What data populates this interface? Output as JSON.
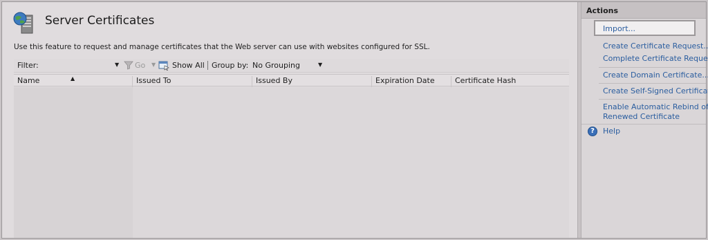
{
  "page": {
    "title": "Server Certificates",
    "description": "Use this feature to request and manage certificates that the Web server can use with websites configured for SSL."
  },
  "toolbar": {
    "filter_label": "Filter:",
    "go_label": "Go",
    "show_all_label": "Show All",
    "group_by_label": "Group by:",
    "group_by_value": "No Grouping"
  },
  "grid": {
    "columns": [
      "Name",
      "Issued To",
      "Issued By",
      "Expiration Date",
      "Certificate Hash"
    ],
    "sorted_column": "Name",
    "rows": []
  },
  "actions": {
    "title": "Actions",
    "items": [
      {
        "label": "Import..."
      },
      {
        "label": "Create Certificate Request..."
      },
      {
        "label": "Complete Certificate Request..."
      },
      {
        "label": "Create Domain Certificate..."
      },
      {
        "label": "Create Self-Signed Certificate..."
      },
      {
        "label": "Enable Automatic Rebind of"
      },
      {
        "label": "Renewed Certificate"
      }
    ],
    "help_label": "Help"
  },
  "icons": {
    "page_icon": "server-certificates-icon",
    "filter_icon": "funnel-icon",
    "show_all_icon": "show-all-icon",
    "help_icon": "help-icon"
  },
  "colors": {
    "link": "#2a5d9f",
    "background": "#e0dcde",
    "actions_header": "#c6c1c3"
  }
}
